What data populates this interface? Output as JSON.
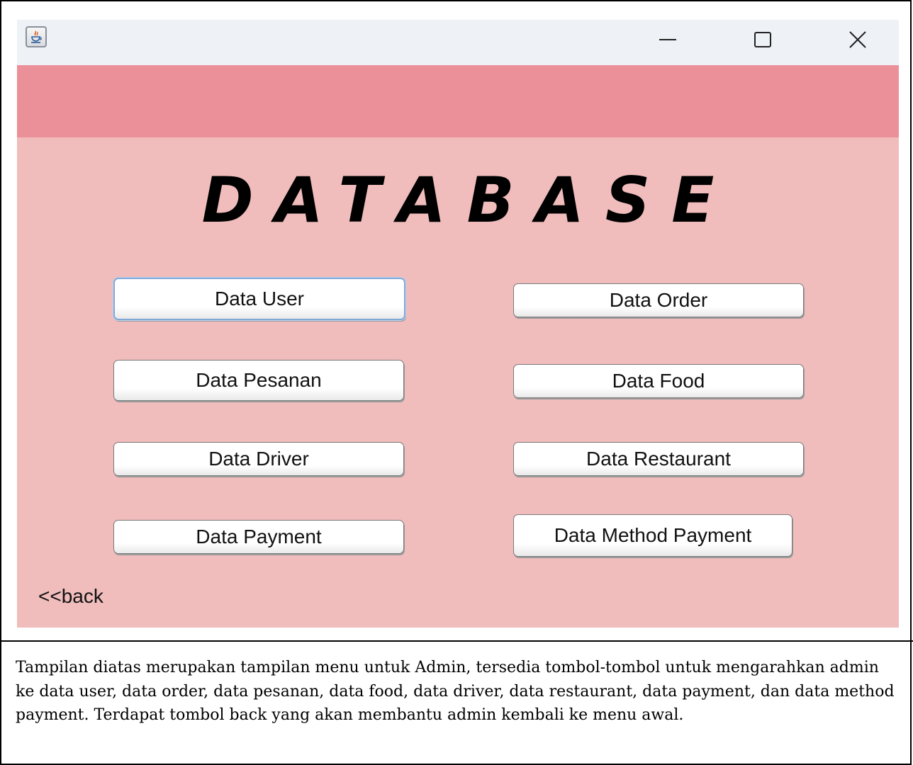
{
  "window": {
    "icon": "java-cup-icon",
    "controls": {
      "minimize": "minimize-icon",
      "maximize": "maximize-icon",
      "close": "close-icon"
    }
  },
  "heading": "DATABASE",
  "buttons": {
    "data_user": "Data User",
    "data_order": "Data Order",
    "data_pesanan": "Data Pesanan",
    "data_food": "Data Food",
    "data_driver": "Data Driver",
    "data_restaurant": "Data Restaurant",
    "data_payment": "Data Payment",
    "data_method_payment": "Data Method Payment"
  },
  "back_label": "<<back",
  "caption": "Tampilan diatas merupakan tampilan menu untuk Admin, tersedia tombol-tombol untuk mengarahkan admin ke data user, data order, data pesanan, data food, data driver, data restaurant, data payment, dan data method payment. Terdapat tombol back yang akan membantu admin kembali ke menu awal.",
  "colors": {
    "title_bar": "#eef1f5",
    "header_band": "#eb9098",
    "panel_background": "#f0bcbc",
    "focus_ring": "#7fa8d8"
  }
}
